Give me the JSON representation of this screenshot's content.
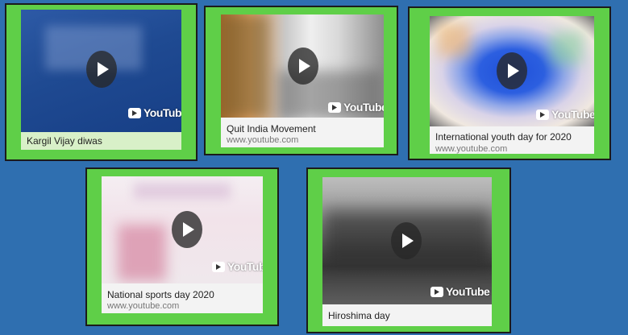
{
  "colors": {
    "background": "#2f6fb0",
    "card_border_fill": "#5fcf48",
    "caption_bg": "#f3f3f3"
  },
  "brand_label": "YouTube",
  "cards": [
    {
      "title": "Kargil Vijay diwas",
      "url": ""
    },
    {
      "title": "Quit India Movement",
      "url": "www.youtube.com"
    },
    {
      "title": "International youth day for 2020",
      "url": "www.youtube.com"
    },
    {
      "title": "National sports day 2020",
      "url": "www.youtube.com"
    },
    {
      "title": "Hiroshima day",
      "url": ""
    }
  ],
  "icons": {
    "play": "play-icon",
    "brand": "youtube-logo-icon"
  }
}
